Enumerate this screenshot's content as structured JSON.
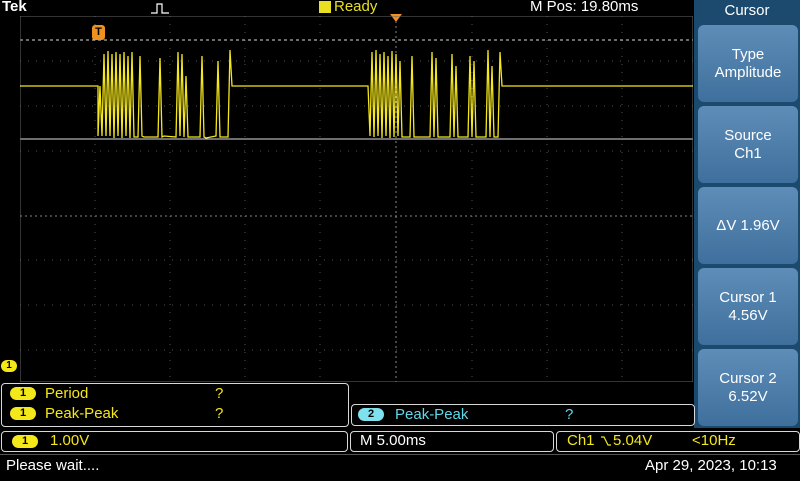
{
  "header": {
    "brand": "Tek",
    "status": "Ready",
    "m_pos": "M Pos: 19.80ms"
  },
  "markers": {
    "trigger": "T",
    "channel_ref": "1"
  },
  "side_menu": {
    "title": "Cursor",
    "buttons": [
      {
        "line1": "Type",
        "line2": "Amplitude"
      },
      {
        "line1": "Source",
        "line2": "Ch1"
      },
      {
        "line1": "ΔV 1.96V",
        "line2": ""
      },
      {
        "line1": "Cursor 1",
        "line2": "4.56V"
      },
      {
        "line1": "Cursor 2",
        "line2": "6.52V"
      }
    ]
  },
  "measurements": {
    "ch1": [
      {
        "badge": "1",
        "label": "Period",
        "value": "?"
      },
      {
        "badge": "1",
        "label": "Peak-Peak",
        "value": "?"
      }
    ],
    "ch2": {
      "badge": "2",
      "label": "Peak-Peak",
      "value": "?"
    }
  },
  "status": {
    "ch_badge": "1",
    "ch_scale": "1.00V",
    "timebase": "M 5.00ms",
    "trigger_src": "Ch1",
    "trigger_level": "5.04V",
    "trigger_freq": "<10Hz"
  },
  "message": "Please wait....",
  "datetime": "Apr 29, 2023, 10:13",
  "colors": {
    "ch1": "#f4e71a",
    "ch2": "#7fe0ee",
    "menu_bg": "#1b4a6e",
    "button": "#4a7aa8",
    "trigger_marker": "#f09020"
  }
}
